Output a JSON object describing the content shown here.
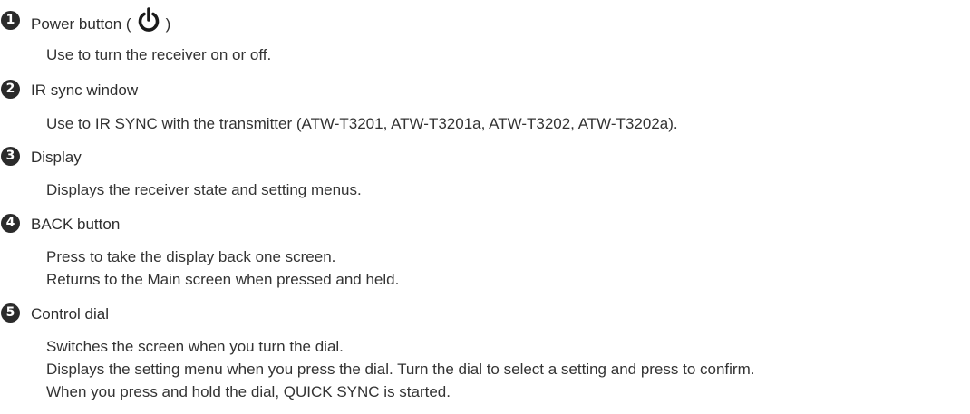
{
  "items": [
    {
      "number": "1",
      "title_prefix": "Power button (",
      "title_suffix": ")",
      "icon": "power-icon",
      "lines": [
        "Use to turn the receiver on or off."
      ]
    },
    {
      "number": "2",
      "title": "IR sync window",
      "lines": [
        "Use to IR SYNC with the transmitter (ATW-T3201, ATW-T3201a, ATW-T3202, ATW-T3202a)."
      ]
    },
    {
      "number": "3",
      "title": "Display",
      "lines": [
        "Displays the receiver state and setting menus."
      ]
    },
    {
      "number": "4",
      "title": "BACK button",
      "lines": [
        "Press to take the display back one screen.",
        "Returns to the Main screen when pressed and held."
      ]
    },
    {
      "number": "5",
      "title": "Control dial",
      "lines": [
        "Switches the screen when you turn the dial.",
        "Displays the setting menu when you press the dial. Turn the dial to select a setting and press to confirm.",
        "When you press and hold the dial, QUICK SYNC is started."
      ]
    }
  ]
}
